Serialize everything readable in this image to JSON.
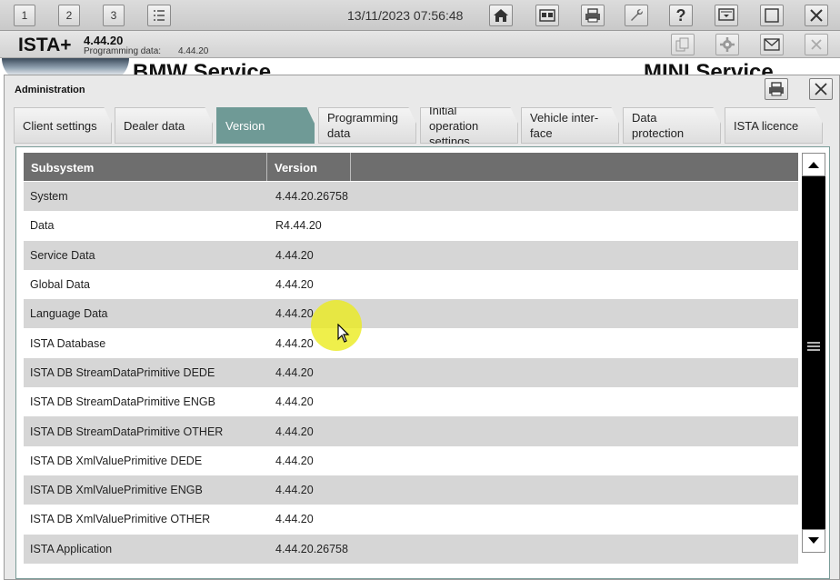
{
  "toolbar": {
    "buttons": [
      {
        "id": "workspace-1",
        "label": "1"
      },
      {
        "id": "workspace-2",
        "label": "2"
      },
      {
        "id": "workspace-3",
        "label": "3"
      }
    ],
    "datetime": "13/11/2023 07:56:48",
    "icons": [
      "list-icon",
      "home-icon",
      "id-card-icon",
      "printer-icon",
      "wrench-icon",
      "help-icon",
      "monitor-icon",
      "window-icon",
      "close-icon"
    ]
  },
  "appbar": {
    "name": "ISTA+",
    "version": "4.44.20",
    "programming_label": "Programming data:",
    "programming_value": "4.44.20"
  },
  "banner": {
    "left": "BMW Service",
    "right": "MINI Service"
  },
  "dialog": {
    "title": "Administration",
    "tabs": [
      {
        "label": "Client settings",
        "active": false
      },
      {
        "label": "Dealer data",
        "active": false
      },
      {
        "label": "Version",
        "active": true
      },
      {
        "label": "Programming data",
        "active": false
      },
      {
        "label": "Initial operation settings",
        "active": false
      },
      {
        "label": "Vehicle inter-face",
        "active": false
      },
      {
        "label": "Data protection",
        "active": false
      },
      {
        "label": "ISTA licence",
        "active": false
      }
    ],
    "table": {
      "headers": [
        "Subsystem",
        "Version"
      ],
      "rows": [
        [
          "System",
          "4.44.20.26758"
        ],
        [
          "Data",
          "R4.44.20"
        ],
        [
          "Service Data",
          "4.44.20"
        ],
        [
          "Global Data",
          "4.44.20"
        ],
        [
          "Language Data",
          "4.44.20"
        ],
        [
          "ISTA Database",
          "4.44.20"
        ],
        [
          "ISTA DB StreamDataPrimitive DEDE",
          "4.44.20"
        ],
        [
          "ISTA DB StreamDataPrimitive ENGB",
          "4.44.20"
        ],
        [
          "ISTA DB StreamDataPrimitive OTHER",
          "4.44.20"
        ],
        [
          "ISTA DB XmlValuePrimitive DEDE",
          "4.44.20"
        ],
        [
          "ISTA DB XmlValuePrimitive ENGB",
          "4.44.20"
        ],
        [
          "ISTA DB XmlValuePrimitive OTHER",
          "4.44.20"
        ],
        [
          "ISTA Application",
          "4.44.20.26758"
        ]
      ]
    }
  },
  "colors": {
    "active_tab": "#6f9a96",
    "header_bg": "#6e6e6e",
    "row_alt": "#d6d6d6"
  }
}
